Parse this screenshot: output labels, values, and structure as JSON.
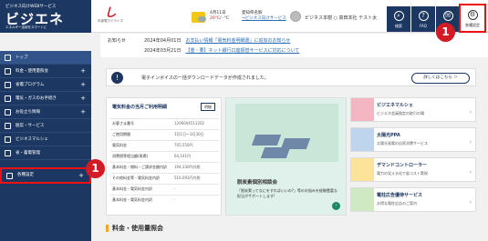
{
  "header": {
    "logo_top": "ビジネス向けWEBサービス",
    "logo_main": "ビジエネ",
    "logo_sub": "エネルギー活用をスマートに",
    "brand_mark": "し",
    "brand_name": "中部電力ミライズ",
    "date": "4月11日",
    "area": "愛知県名駅",
    "temp_hi": "26°C",
    "temp_lo": "/ -°C",
    "pollen": "→ビジネス向けサービス",
    "user": "ビジネス本樹 ○ 高田本社 テスト太",
    "buttons": [
      {
        "label": "検索",
        "icon": "⌕"
      },
      {
        "label": "FAQ",
        "icon": "?"
      },
      {
        "label": "",
        "icon": "✉"
      },
      {
        "label": "各種設定",
        "icon": "⚙"
      }
    ]
  },
  "notice": {
    "label": "お知らせ",
    "items": [
      {
        "date": "2024年04月01日",
        "text": "お支払い情報「電気料金明細書」に追加のお知らせ"
      },
      {
        "date": "2024年03月21日",
        "text": "【重・要】ネット銀行口座振替サービスに対応について"
      }
    ]
  },
  "sidebar": {
    "items": [
      {
        "label": "トップ"
      },
      {
        "label": "料金・使用量照会"
      },
      {
        "label": "省電プログラム"
      },
      {
        "label": "電気・ガスのお手続き"
      },
      {
        "label": "お役立ち情報"
      },
      {
        "label": "脱炭・サービス"
      },
      {
        "label": "ビジネスマルシェ"
      },
      {
        "label": "省・蓄電管理"
      },
      {
        "label": "各種設定"
      }
    ]
  },
  "infobar": {
    "text": "電子インボイスの一括ダウンロードデータが作成されました。",
    "more": "詳しくはこちら ＞"
  },
  "billing": {
    "title": "電気料金の当月ご利用明細",
    "download": "明細",
    "rows": [
      {
        "k": "お客さま番号",
        "v": "1206004511202"
      },
      {
        "k": "ご使用期間",
        "v": "3月1日〜3月30日"
      },
      {
        "k": "電気料金",
        "v": "705,550円"
      },
      {
        "k": "消費税等相当額(再掲)",
        "v": "64,141円"
      },
      {
        "k": "基本料金・燃料・ご請求金額内訳",
        "v": "194,330円内税"
      },
      {
        "k": "その他料金等・電気料金内訳",
        "v": "516,093円内税"
      },
      {
        "k": "基本料金・電気料金内訳",
        "v": "-"
      },
      {
        "k": "基本料金・電気料金内訳",
        "v": "-"
      }
    ]
  },
  "promo": {
    "title": "脱炭素個別相談会",
    "desc": "「脱炭素ってなにをすればいいの?」等のお悩みを経験豊富な担当がサポートします!",
    "arrow": "›"
  },
  "services": [
    {
      "name": "ビジエネマルシェ",
      "desc": "ビジエネ会員限定の取引の場",
      "color": "#f4b6c2"
    },
    {
      "name": "太陽光PPA",
      "desc": "太陽光発電の自家消費サービス",
      "color": "#bfd5ee"
    },
    {
      "name": "デマンドコントローラー",
      "desc": "電力の見える化で省コスト実現",
      "color": "#fbe39a"
    },
    {
      "name": "電柱広告優待サービス",
      "desc": "お得な電柱広告のご案内",
      "color": "#cfe9c2"
    }
  ],
  "section": {
    "title": "料金・使用量照会"
  },
  "callouts": [
    "1",
    "1"
  ]
}
